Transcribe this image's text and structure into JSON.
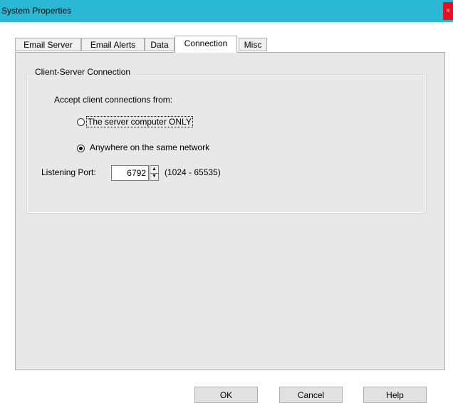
{
  "window": {
    "title": "System Properties",
    "close_glyph": "×"
  },
  "tabs": [
    {
      "label": "Email Server"
    },
    {
      "label": "Email Alerts"
    },
    {
      "label": "Data"
    },
    {
      "label": "Connection"
    },
    {
      "label": "Misc"
    }
  ],
  "active_tab": "Connection",
  "connection": {
    "group_title": "Client-Server Connection",
    "accept_label": "Accept client connections from:",
    "options": [
      {
        "label": "The server computer ONLY",
        "selected": false
      },
      {
        "label": "Anywhere on the same network",
        "selected": true
      }
    ],
    "port_label": "Listening Port:",
    "port_value": "6792",
    "port_range": "(1024 - 65535)"
  },
  "buttons": {
    "ok": "OK",
    "cancel": "Cancel",
    "help": "Help"
  },
  "icons": {
    "spin_up": "▲",
    "spin_down": "▼"
  },
  "colors": {
    "titlebar": "#2ab8d4",
    "close": "#e81123",
    "panel": "#e8e8e8"
  }
}
